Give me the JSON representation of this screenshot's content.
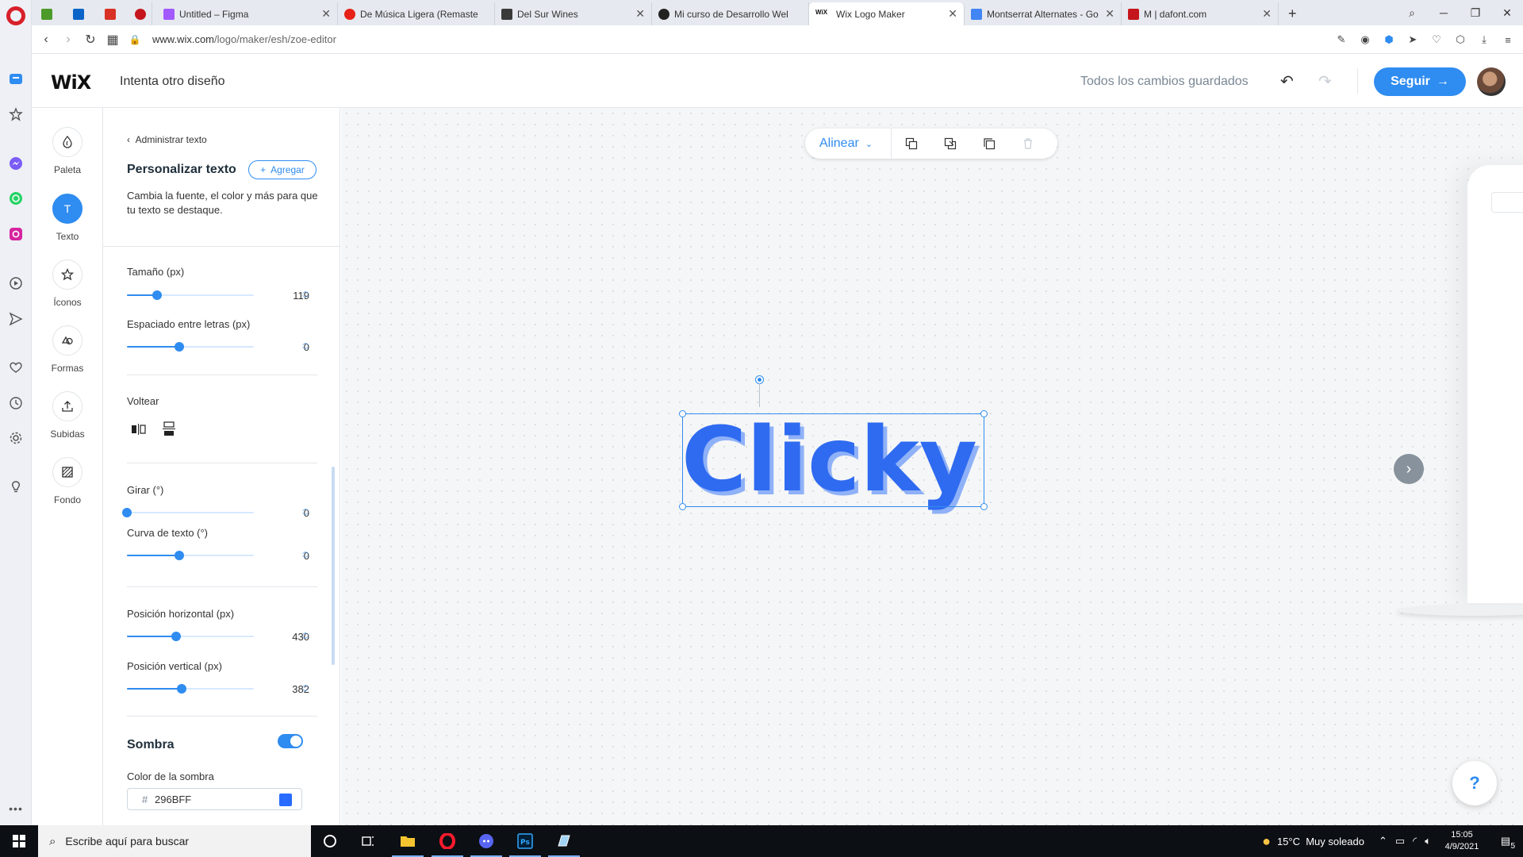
{
  "browser": {
    "tabs": [
      {
        "label": "",
        "favicon_color": "#4c9a2a"
      },
      {
        "label": "",
        "favicon_color": "#0a64c8"
      },
      {
        "label": "",
        "favicon_color": "#d93025"
      },
      {
        "label": "",
        "favicon_color": "#c4161c"
      },
      {
        "label": "Untitled – Figma",
        "favicon_color": "#a259ff"
      },
      {
        "label": "De Música Ligera (Remaste",
        "favicon_color": "#e62117"
      },
      {
        "label": "Del Sur Wines",
        "favicon_color": "#3a3a3a"
      },
      {
        "label": "Mi curso de Desarrollo Wel",
        "favicon_color": "#222222"
      },
      {
        "label": "Wix Logo Maker",
        "favicon_color": "#111111",
        "favicon_text": "WiX"
      },
      {
        "label": "Montserrat Alternates - Go",
        "favicon_color": "#4285f4"
      },
      {
        "label": "M | dafont.com",
        "favicon_color": "#c4161c"
      }
    ],
    "url_host": "www.wix.com",
    "url_path": "/logo/maker/esh/zoe-editor"
  },
  "header": {
    "logo": "WiX",
    "title": "Intenta otro diseño",
    "saved_status": "Todos los cambios guardados",
    "follow_label": "Seguir"
  },
  "tools": [
    {
      "label": "Paleta",
      "icon": "palette-drop-icon",
      "active": false
    },
    {
      "label": "Texto",
      "icon": "text-icon",
      "active": true
    },
    {
      "label": "Íconos",
      "icon": "star-icon",
      "active": false
    },
    {
      "label": "Formas",
      "icon": "shapes-icon",
      "active": false
    },
    {
      "label": "Subidas",
      "icon": "upload-icon",
      "active": false
    },
    {
      "label": "Fondo",
      "icon": "background-icon",
      "active": false
    }
  ],
  "panel": {
    "back_label": "Administrar texto",
    "title": "Personalizar texto",
    "add_label": "Agregar",
    "description": "Cambia la fuente, el color y más para que tu texto se destaque.",
    "size": {
      "label": "Tamaño (px)",
      "value": "119",
      "fraction": 0.24
    },
    "spacing": {
      "label": "Espaciado entre letras (px)",
      "value": "0",
      "fraction": 0.41
    },
    "flip_label": "Voltear",
    "rotate": {
      "label": "Girar (°)",
      "value": "0",
      "fraction": 0.0
    },
    "curve": {
      "label": "Curva de texto (°)",
      "value": "0",
      "fraction": 0.41
    },
    "pos_x": {
      "label": "Posición horizontal (px)",
      "value": "430",
      "fraction": 0.39
    },
    "pos_y": {
      "label": "Posición vertical (px)",
      "value": "382",
      "fraction": 0.43
    },
    "shadow_label": "Sombra",
    "shadow_enabled": true,
    "shadow_color_label": "Color de la sombra",
    "shadow_color_hash": "#",
    "shadow_color_value": "296BFF",
    "shadow_color": "#296BFF"
  },
  "canvas": {
    "align_label": "Alinear",
    "logo_text": "Clicky",
    "logo_color": "#2F6BF0",
    "logo_shadow_color": "#8FB1F7"
  },
  "taskbar": {
    "search_placeholder": "Escribe aquí para buscar",
    "weather": "15°C  Muy soleado",
    "time": "15:05",
    "date": "4/9/2021",
    "notification_count": "5"
  },
  "colors": {
    "accent": "#2F8CF0"
  }
}
